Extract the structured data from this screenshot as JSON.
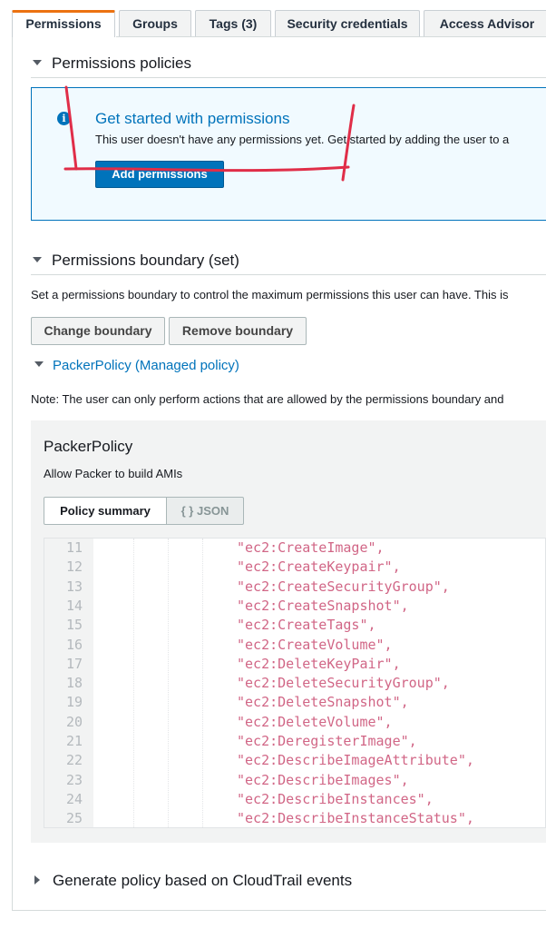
{
  "tabs": [
    {
      "label": "Permissions",
      "active": true
    },
    {
      "label": "Groups",
      "active": false
    },
    {
      "label": "Tags (3)",
      "active": false
    },
    {
      "label": "Security credentials",
      "active": false
    },
    {
      "label": "Access Advisor",
      "active": false
    }
  ],
  "permissions_policies": {
    "heading": "Permissions policies",
    "info": {
      "icon": "info-icon",
      "title": "Get started with permissions",
      "text": "This user doesn't have any permissions yet. Get started by adding the user to a",
      "button": "Add permissions"
    }
  },
  "permissions_boundary": {
    "heading": "Permissions boundary (set)",
    "description": "Set a permissions boundary to control the maximum permissions this user can have. This is",
    "change_button": "Change boundary",
    "remove_button": "Remove boundary",
    "policy_link": "PackerPolicy (Managed policy)",
    "note": "Note: The user can only perform actions that are allowed by the permissions boundary and"
  },
  "policy": {
    "name": "PackerPolicy",
    "description": "Allow Packer to build AMIs",
    "tab_summary": "Policy summary",
    "tab_json": "{ } JSON",
    "code_lines": [
      {
        "n": "11",
        "text": "\"ec2:CreateImage\","
      },
      {
        "n": "12",
        "text": "\"ec2:CreateKeypair\","
      },
      {
        "n": "13",
        "text": "\"ec2:CreateSecurityGroup\","
      },
      {
        "n": "14",
        "text": "\"ec2:CreateSnapshot\","
      },
      {
        "n": "15",
        "text": "\"ec2:CreateTags\","
      },
      {
        "n": "16",
        "text": "\"ec2:CreateVolume\","
      },
      {
        "n": "17",
        "text": "\"ec2:DeleteKeyPair\","
      },
      {
        "n": "18",
        "text": "\"ec2:DeleteSecurityGroup\","
      },
      {
        "n": "19",
        "text": "\"ec2:DeleteSnapshot\","
      },
      {
        "n": "20",
        "text": "\"ec2:DeleteVolume\","
      },
      {
        "n": "21",
        "text": "\"ec2:DeregisterImage\","
      },
      {
        "n": "22",
        "text": "\"ec2:DescribeImageAttribute\","
      },
      {
        "n": "23",
        "text": "\"ec2:DescribeImages\","
      },
      {
        "n": "24",
        "text": "\"ec2:DescribeInstances\","
      },
      {
        "n": "25",
        "text": "\"ec2:DescribeInstanceStatus\","
      }
    ]
  },
  "cloudtrail": {
    "heading": "Generate policy based on CloudTrail events"
  },
  "colors": {
    "accent_blue": "#0073bb",
    "tab_active_orange": "#ec7211",
    "annotation_red": "#e02d48",
    "code_string": "#d16686"
  }
}
